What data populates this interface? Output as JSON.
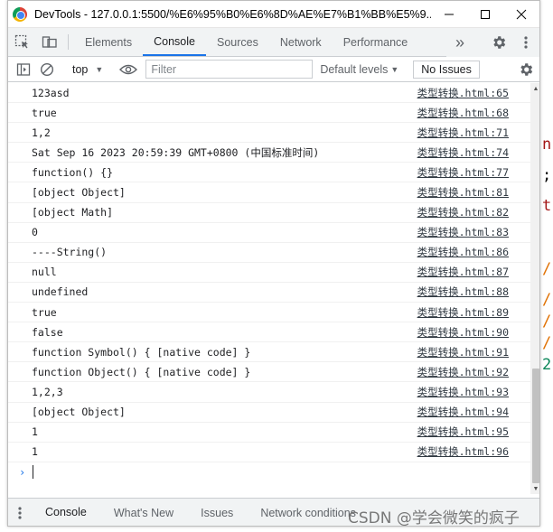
{
  "window": {
    "title": "DevTools - 127.0.0.1:5500/%E6%95%B0%E6%8D%AE%E7%B1%BB%E5%9..."
  },
  "background_editor": {
    "glyphs": [
      "n",
      ";",
      "t",
      "/",
      "/",
      "/",
      "/",
      "2"
    ]
  },
  "tabs": [
    {
      "label": "Elements"
    },
    {
      "label": "Console"
    },
    {
      "label": "Sources"
    },
    {
      "label": "Network"
    },
    {
      "label": "Performance"
    }
  ],
  "tabs_overflow": "»",
  "toolbar": {
    "context": "top",
    "filter_placeholder": "Filter",
    "levels_label": "Default levels",
    "issues_label": "No Issues"
  },
  "console_rows": [
    {
      "msg": "123asd",
      "src": "类型转换.html:65"
    },
    {
      "msg": "true",
      "src": "类型转换.html:68"
    },
    {
      "msg": "1,2",
      "src": "类型转换.html:71"
    },
    {
      "msg": "Sat Sep 16 2023 20:59:39 GMT+0800 (中国标准时间)",
      "src": "类型转换.html:74"
    },
    {
      "msg": "function() {}",
      "src": "类型转换.html:77"
    },
    {
      "msg": "[object Object]",
      "src": "类型转换.html:81"
    },
    {
      "msg": "[object Math]",
      "src": "类型转换.html:82"
    },
    {
      "msg": "0",
      "src": "类型转换.html:83"
    },
    {
      "msg": "----String()",
      "src": "类型转换.html:86"
    },
    {
      "msg": "null",
      "src": "类型转换.html:87"
    },
    {
      "msg": "undefined",
      "src": "类型转换.html:88"
    },
    {
      "msg": "true",
      "src": "类型转换.html:89"
    },
    {
      "msg": "false",
      "src": "类型转换.html:90"
    },
    {
      "msg": "function Symbol() { [native code] }",
      "src": "类型转换.html:91"
    },
    {
      "msg": "function Object() { [native code] }",
      "src": "类型转换.html:92"
    },
    {
      "msg": "1,2,3",
      "src": "类型转换.html:93"
    },
    {
      "msg": "[object Object]",
      "src": "类型转换.html:94"
    },
    {
      "msg": "1",
      "src": "类型转换.html:95"
    },
    {
      "msg": "1",
      "src": "类型转换.html:96"
    }
  ],
  "prompt_symbol": "›",
  "drawer_tabs": [
    {
      "label": "Console"
    },
    {
      "label": "What's New"
    },
    {
      "label": "Issues"
    },
    {
      "label": "Network conditions"
    }
  ],
  "watermark": "CSDN @学会微笑的疯子",
  "colors": {
    "accent": "#1a73e8"
  }
}
